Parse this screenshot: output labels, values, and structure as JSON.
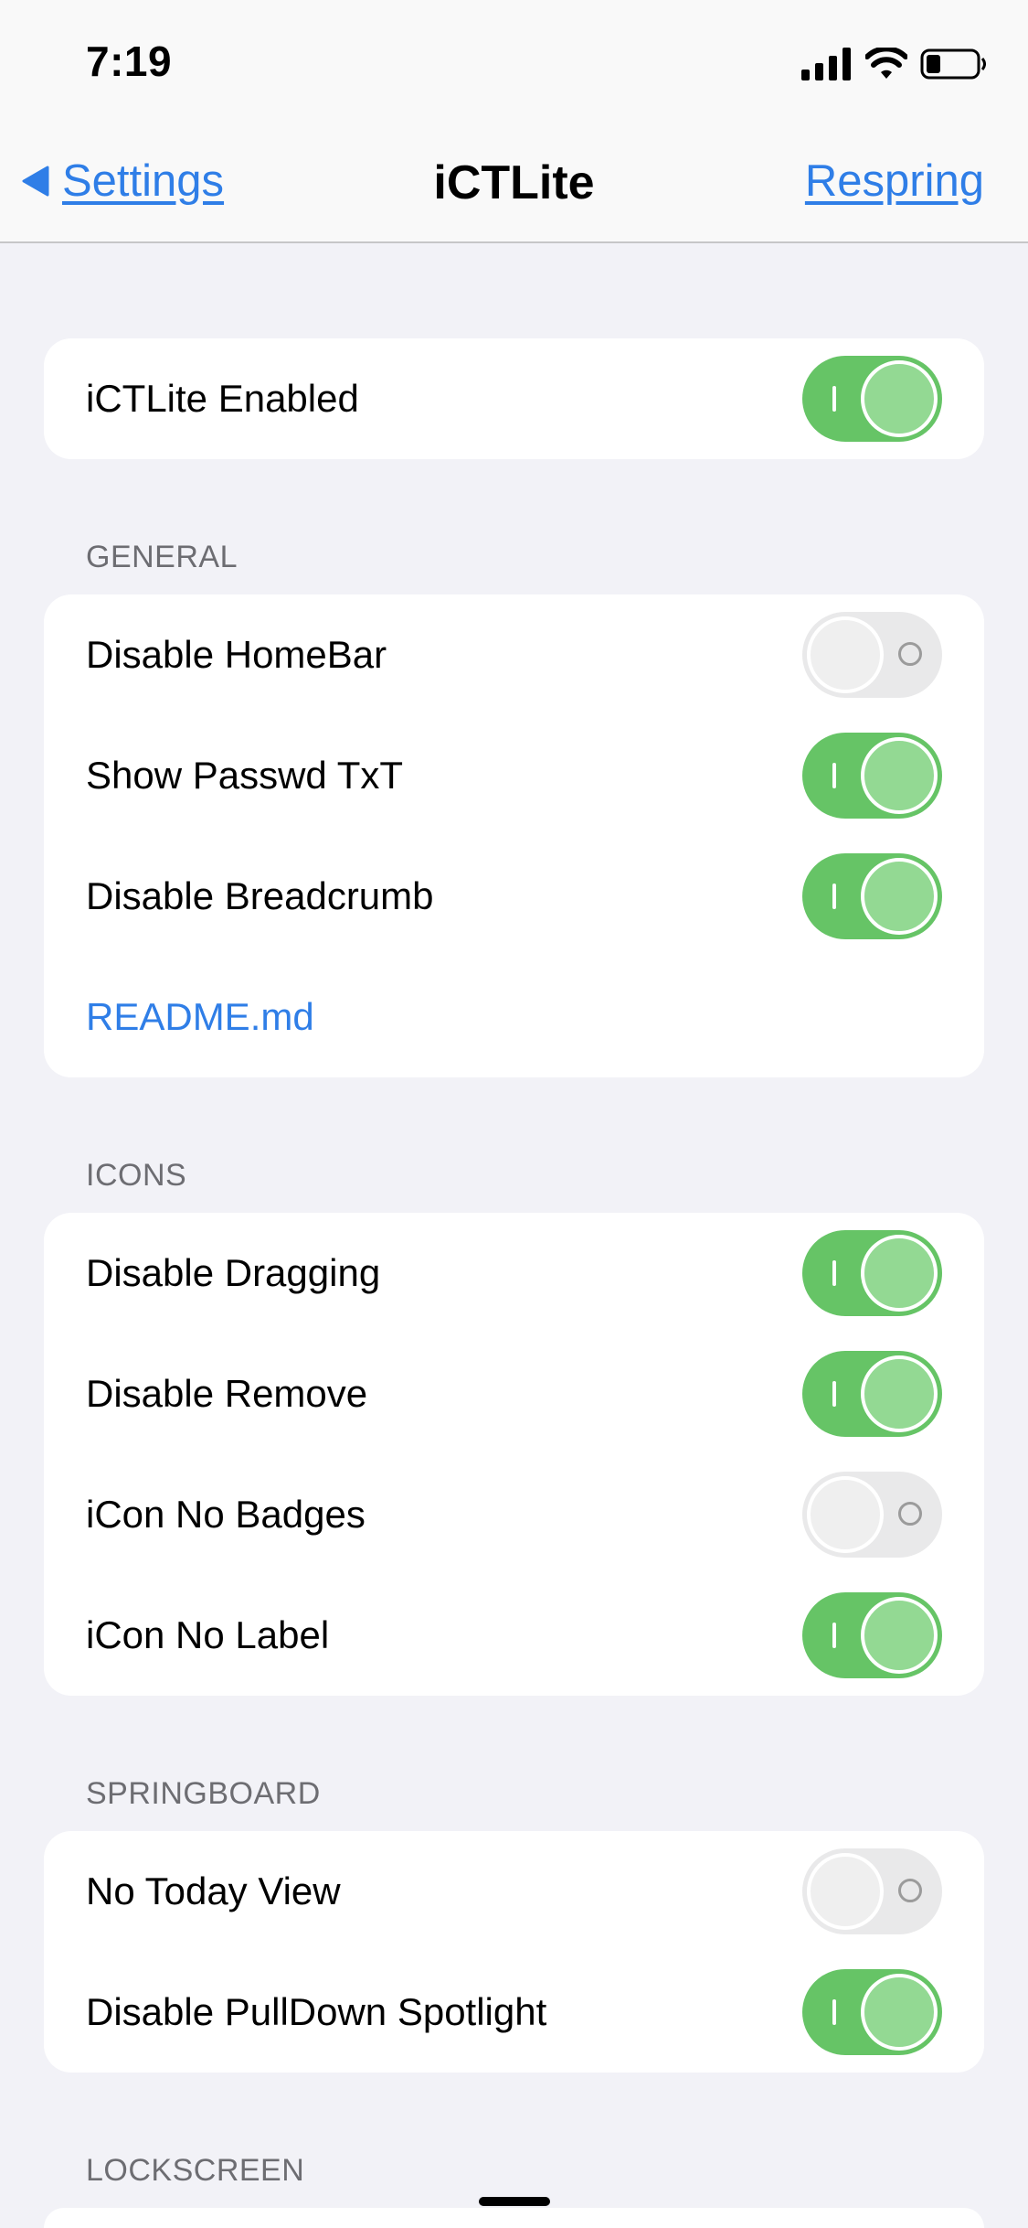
{
  "status_bar": {
    "time": "7:19",
    "icons": [
      "signal-icon",
      "wifi-icon",
      "battery-icon"
    ]
  },
  "nav": {
    "back_label": "Settings",
    "title": "iCTLite",
    "action_label": "Respring"
  },
  "colors": {
    "accent": "#2f7ee7",
    "switch_on": "#66c466",
    "switch_off": "#e9e9ea",
    "background": "#f2f2f7"
  },
  "main_toggle": {
    "label": "iCTLite Enabled",
    "on": true
  },
  "sections": [
    {
      "header": "GENERAL",
      "items": [
        {
          "label": "Disable HomeBar",
          "on": false
        },
        {
          "label": "Show Passwd TxT",
          "on": true
        },
        {
          "label": "Disable Breadcrumb",
          "on": true
        }
      ],
      "link": "README.md"
    },
    {
      "header": "ICONS",
      "items": [
        {
          "label": "Disable Dragging",
          "on": true
        },
        {
          "label": "Disable Remove",
          "on": true
        },
        {
          "label": "iCon No Badges",
          "on": false
        },
        {
          "label": "iCon No Label",
          "on": true
        }
      ]
    },
    {
      "header": "SPRINGBOARD",
      "items": [
        {
          "label": "No Today View",
          "on": false
        },
        {
          "label": "Disable PullDown Spotlight",
          "on": true
        }
      ]
    },
    {
      "header": "LOCKSCREEN",
      "items": []
    }
  ]
}
